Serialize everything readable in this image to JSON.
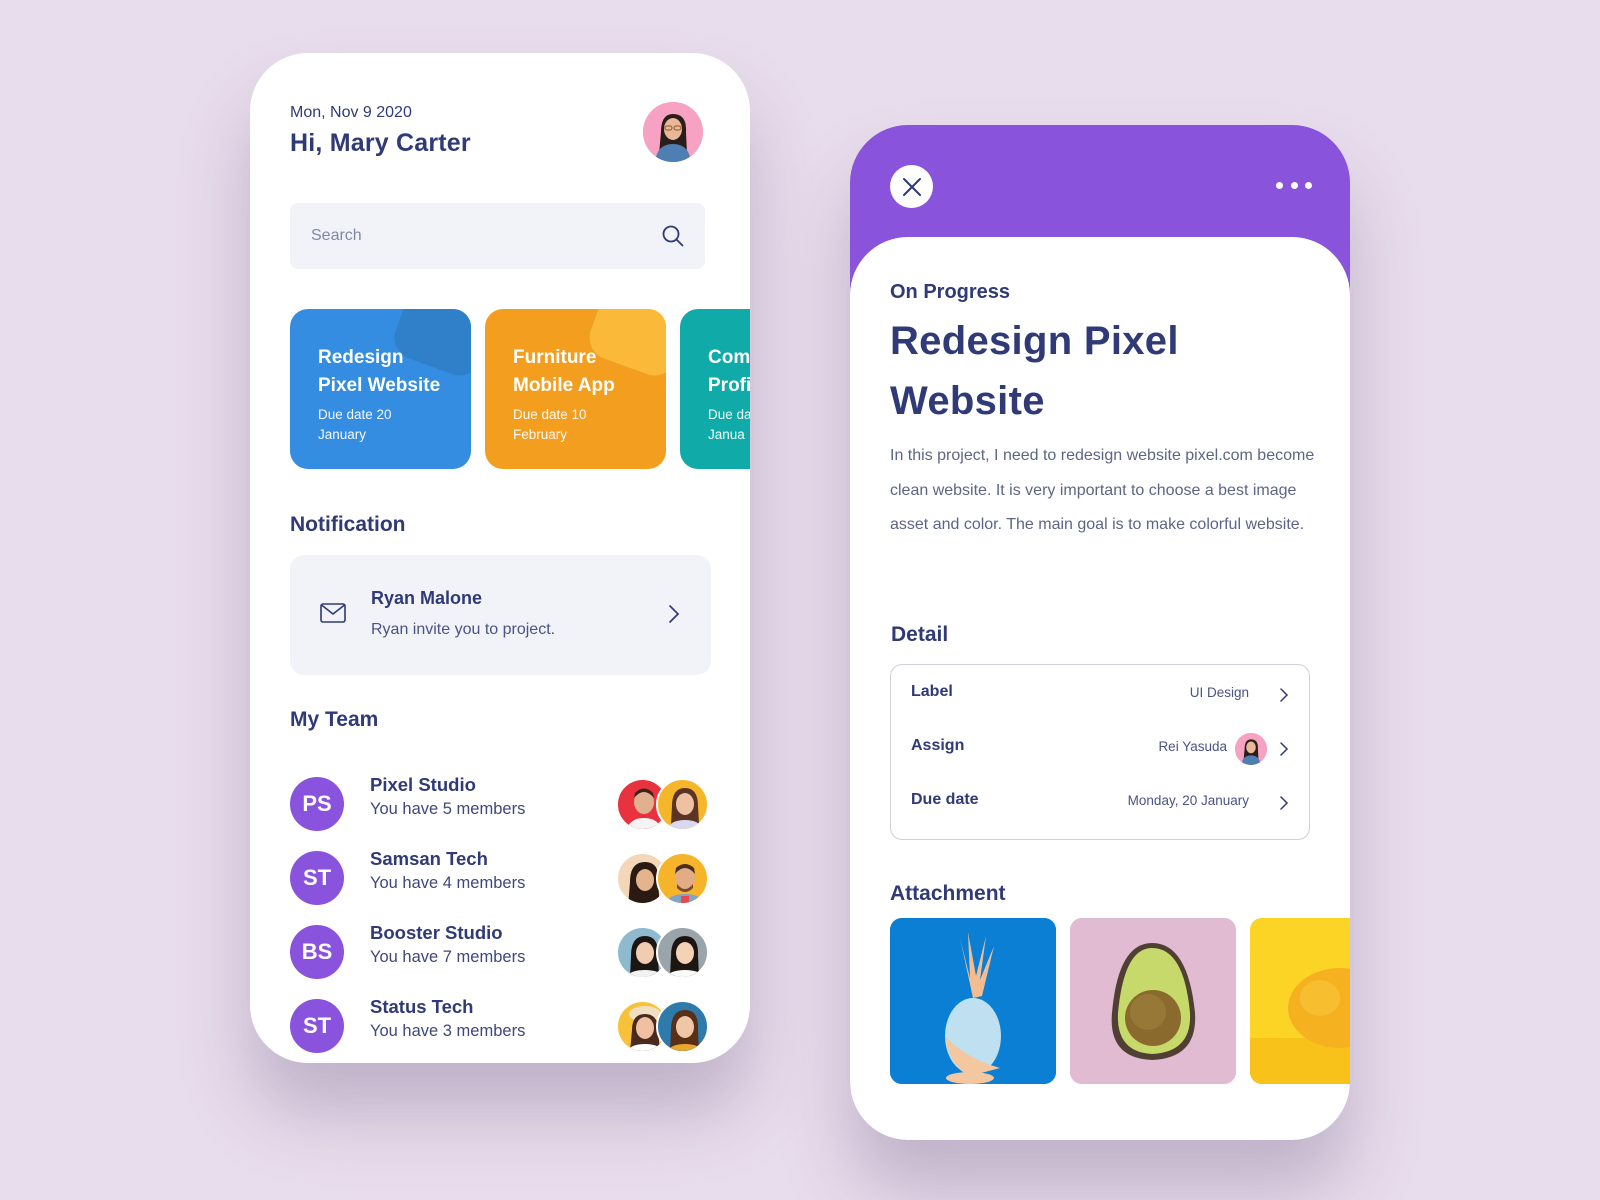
{
  "colors": {
    "background": "#e8ddec",
    "primary_text": "#2f3a76",
    "accent_purple": "#8953dc",
    "card_blue": "#348de0",
    "card_orange": "#f49e1f",
    "card_teal": "#10aaa9"
  },
  "home": {
    "date": "Mon, Nov 9 2020",
    "greeting": "Hi, Mary Carter",
    "search": {
      "placeholder": "Search",
      "icon": "search-icon"
    },
    "projects": [
      {
        "title_line1": "Redesign",
        "title_line2": "Pixel Website",
        "due_line1": "Due date 20",
        "due_line2": "January",
        "color": "#348de0"
      },
      {
        "title_line1": "Furniture",
        "title_line2": "Mobile App",
        "due_line1": "Due date 10",
        "due_line2": "February",
        "color": "#f49e1f"
      },
      {
        "title_line1": "Com",
        "title_line2": "Profi",
        "due_line1": "Due da",
        "due_line2": "Janua",
        "color": "#10aaa9"
      }
    ],
    "notification": {
      "section_title": "Notification",
      "icon": "mail-icon",
      "name": "Ryan Malone",
      "message": "Ryan invite you to project."
    },
    "team": {
      "section_title": "My Team",
      "items": [
        {
          "initials": "PS",
          "name": "Pixel Studio",
          "members": "You have 5 members"
        },
        {
          "initials": "ST",
          "name": "Samsan Tech",
          "members": "You have 4 members"
        },
        {
          "initials": "BS",
          "name": "Booster Studio",
          "members": "You have 7 members"
        },
        {
          "initials": "ST",
          "name": "Status Tech",
          "members": "You have 3 members"
        }
      ]
    }
  },
  "detail": {
    "close_icon": "close-icon",
    "more_icon": "more-horizontal-icon",
    "status": "On Progress",
    "title": "Redesign Pixel Website",
    "description": "In this project, I need to redesign website pixel.com become clean website. It is very important to choose a best image asset and color. The main goal is to make colorful website.",
    "detail_section_title": "Detail",
    "rows": [
      {
        "label": "Label",
        "value": "UI Design"
      },
      {
        "label": "Assign",
        "value": "Rei Yasuda"
      },
      {
        "label": "Due date",
        "value": "Monday, 20 January"
      }
    ],
    "attachment_section_title": "Attachment",
    "attachments": [
      "pineapple-image",
      "avocado-image",
      "lemon-image"
    ]
  }
}
